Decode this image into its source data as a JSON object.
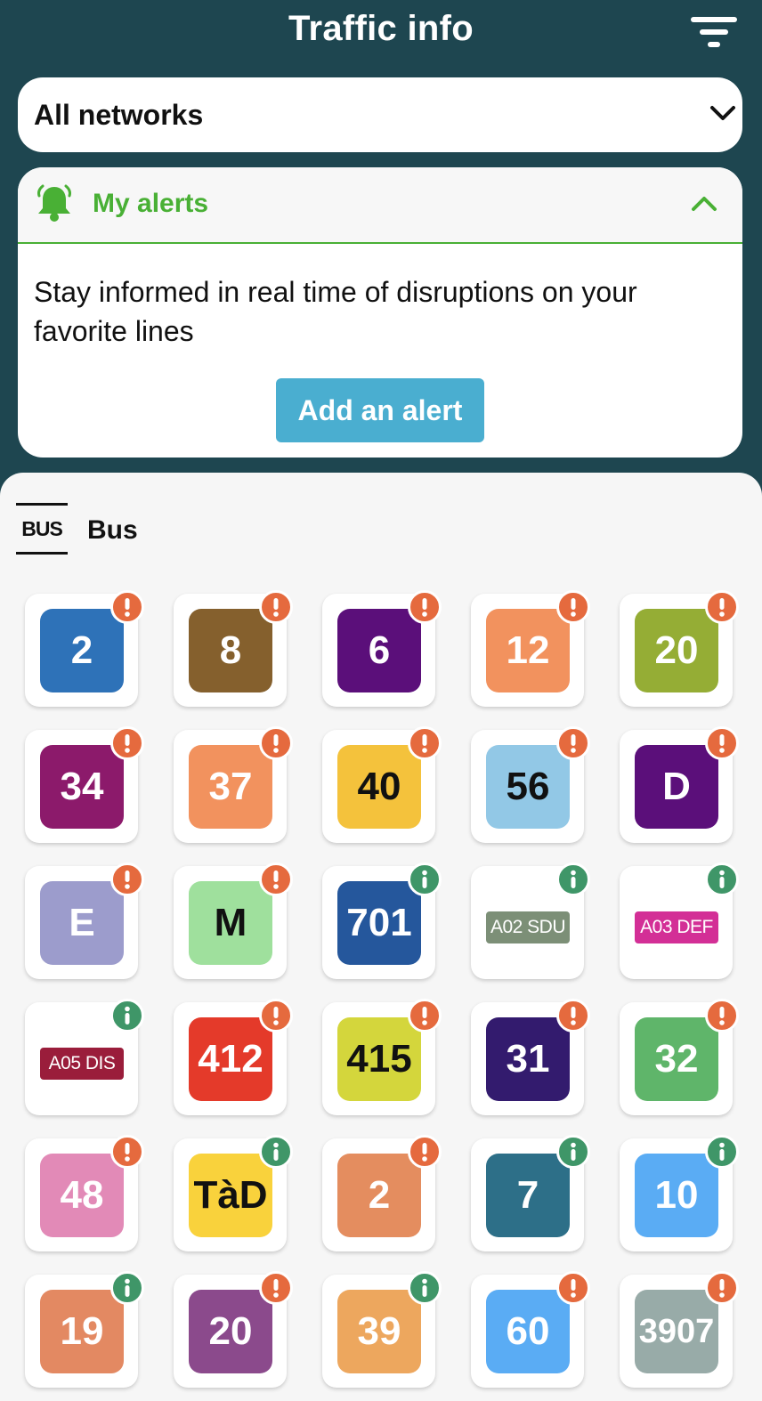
{
  "header": {
    "title": "Traffic info",
    "filter_icon": "filter-icon"
  },
  "network_select": {
    "value": "All networks",
    "icon": "chevron-down-icon"
  },
  "alerts": {
    "title": "My alerts",
    "icon": "bell-icon",
    "toggle_icon": "chevron-up-icon",
    "text": "Stay informed in real time of disruptions on your favorite lines",
    "add_button": "Add an alert",
    "accent_color": "#49b035"
  },
  "mode": {
    "icon_text": "BUS",
    "label": "Bus"
  },
  "lines": [
    {
      "label": "2",
      "color": "#2e72b8",
      "text_color": "#ffffff",
      "status": "alert"
    },
    {
      "label": "8",
      "color": "#85602d",
      "text_color": "#ffffff",
      "status": "alert"
    },
    {
      "label": "6",
      "color": "#5b0f7a",
      "text_color": "#ffffff",
      "status": "alert"
    },
    {
      "label": "12",
      "color": "#f2925e",
      "text_color": "#ffffff",
      "status": "alert"
    },
    {
      "label": "20",
      "color": "#95ad35",
      "text_color": "#ffffff",
      "status": "alert"
    },
    {
      "label": "34",
      "color": "#8c1a6b",
      "text_color": "#ffffff",
      "status": "alert"
    },
    {
      "label": "37",
      "color": "#f2925e",
      "text_color": "#ffffff",
      "status": "alert"
    },
    {
      "label": "40",
      "color": "#f4c23c",
      "text_color": "#111111",
      "status": "alert"
    },
    {
      "label": "56",
      "color": "#92c8e6",
      "text_color": "#111111",
      "status": "alert"
    },
    {
      "label": "D",
      "color": "#5b0f7a",
      "text_color": "#ffffff",
      "status": "alert"
    },
    {
      "label": "E",
      "color": "#9c9ccc",
      "text_color": "#ffffff",
      "status": "alert"
    },
    {
      "label": "M",
      "color": "#9fe09d",
      "text_color": "#111111",
      "status": "alert"
    },
    {
      "label": "701",
      "color": "#25579c",
      "text_color": "#ffffff",
      "status": "info"
    },
    {
      "label": "A02 SDU",
      "color": "#7c8f77",
      "text_color": "#ffffff",
      "status": "info",
      "small": true
    },
    {
      "label": "A03 DEF",
      "color": "#d32f96",
      "text_color": "#ffffff",
      "status": "info",
      "small": true
    },
    {
      "label": "A05 DIS",
      "color": "#9a1d3b",
      "text_color": "#ffffff",
      "status": "info",
      "small": true
    },
    {
      "label": "412",
      "color": "#e43a2a",
      "text_color": "#ffffff",
      "status": "alert"
    },
    {
      "label": "415",
      "color": "#d4d63c",
      "text_color": "#111111",
      "status": "alert"
    },
    {
      "label": "31",
      "color": "#331b6e",
      "text_color": "#ffffff",
      "status": "alert"
    },
    {
      "label": "32",
      "color": "#5fb56a",
      "text_color": "#ffffff",
      "status": "alert"
    },
    {
      "label": "48",
      "color": "#e28ab7",
      "text_color": "#ffffff",
      "status": "alert"
    },
    {
      "label": "TàD",
      "color": "#f9d23c",
      "text_color": "#111111",
      "status": "info"
    },
    {
      "label": "2",
      "color": "#e48d5f",
      "text_color": "#ffffff",
      "status": "alert"
    },
    {
      "label": "7",
      "color": "#2d6f88",
      "text_color": "#ffffff",
      "status": "info"
    },
    {
      "label": "10",
      "color": "#5aacf4",
      "text_color": "#ffffff",
      "status": "info"
    },
    {
      "label": "19",
      "color": "#e38962",
      "text_color": "#ffffff",
      "status": "info"
    },
    {
      "label": "20",
      "color": "#8b4a8c",
      "text_color": "#ffffff",
      "status": "alert"
    },
    {
      "label": "39",
      "color": "#eda75e",
      "text_color": "#ffffff",
      "status": "info"
    },
    {
      "label": "60",
      "color": "#5aacf4",
      "text_color": "#ffffff",
      "status": "alert"
    },
    {
      "label": "3907",
      "color": "#98aba8",
      "text_color": "#ffffff",
      "status": "alert"
    }
  ],
  "status_colors": {
    "alert": "#e56a3e",
    "info": "#3f9668"
  }
}
